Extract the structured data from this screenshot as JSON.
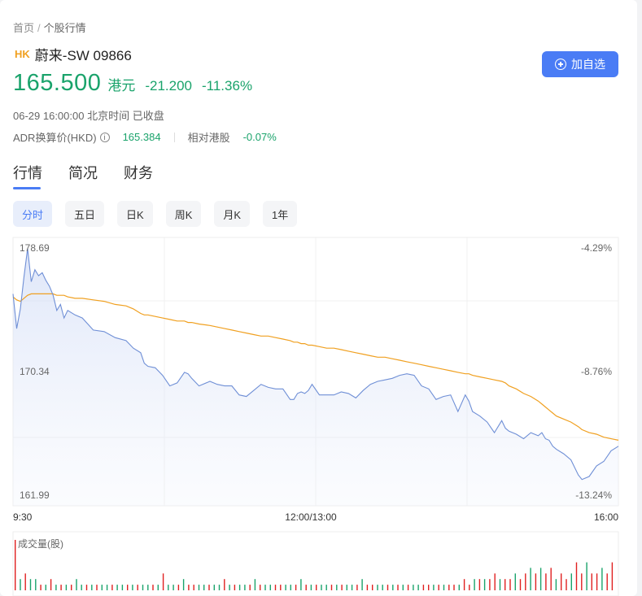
{
  "breadcrumb": {
    "home": "首页",
    "separator": "/",
    "current": "个股行情"
  },
  "stock": {
    "market": "HK",
    "name": "蔚来-SW 09866",
    "price": "165.500",
    "unit": "港元",
    "change": "-21.200",
    "change_pct": "-11.36%",
    "time_status": "06-29 16:00:00 北京时间 已收盘"
  },
  "adr": {
    "label": "ADR换算价(HKD)",
    "value": "165.384",
    "rel_label": "相对港股",
    "rel_value": "-0.07%"
  },
  "add_button": "加自选",
  "tabs": [
    "行情",
    "简况",
    "财务"
  ],
  "periods": [
    "分时",
    "五日",
    "日K",
    "周K",
    "月K",
    "1年"
  ],
  "volume_title": "成交量(股)",
  "colors": {
    "up": "#e02020",
    "down": "#1aa36b",
    "accent": "#4a7cf5",
    "price_line": "#6f8fd6",
    "avg_line": "#f0a020"
  },
  "chart_data": {
    "type": "line",
    "y_left_ticks": [
      "178.69",
      "170.34",
      "161.99"
    ],
    "y_right_ticks": [
      "-4.29%",
      "-8.76%",
      "-13.24%"
    ],
    "x_ticks": [
      "9:30",
      "12:00/13:00",
      "16:00"
    ],
    "ylim": [
      161.99,
      178.69
    ],
    "x": [
      0,
      2,
      4,
      6,
      8,
      10,
      12,
      14,
      16,
      18,
      20,
      22,
      24,
      26,
      28,
      30,
      34,
      38,
      44,
      50,
      56,
      62,
      66,
      70,
      72,
      74,
      78,
      82,
      86,
      90,
      94,
      96,
      98,
      102,
      108,
      112,
      116,
      120,
      124,
      128,
      132,
      136,
      140,
      144,
      148,
      152,
      154,
      156,
      158,
      160,
      162,
      164,
      168,
      172,
      176,
      180,
      184,
      188,
      192,
      196,
      200,
      204,
      208,
      212,
      216,
      220,
      224,
      228,
      232,
      236,
      240,
      244,
      248,
      250,
      252,
      256,
      260,
      264,
      268,
      270,
      272,
      276,
      280,
      284,
      288,
      290,
      292,
      294,
      296,
      298,
      302,
      306,
      310,
      312,
      316,
      320,
      324,
      328,
      332
    ],
    "price": [
      175.6,
      173.3,
      174.6,
      176.7,
      178.6,
      176.4,
      177.2,
      176.8,
      177.0,
      176.5,
      176.1,
      175.5,
      174.5,
      174.9,
      174.0,
      174.5,
      174.2,
      174.0,
      173.2,
      173.1,
      172.7,
      172.5,
      172.0,
      171.7,
      171.0,
      170.8,
      170.7,
      170.2,
      169.5,
      169.7,
      170.4,
      170.3,
      170.0,
      169.5,
      169.8,
      169.6,
      169.5,
      169.5,
      168.9,
      168.8,
      169.2,
      169.6,
      169.4,
      169.3,
      169.3,
      168.6,
      168.6,
      169.0,
      169.1,
      169.0,
      169.2,
      169.6,
      168.9,
      168.9,
      168.9,
      169.1,
      169.0,
      168.7,
      169.2,
      169.6,
      169.8,
      169.9,
      170.0,
      170.2,
      170.3,
      170.2,
      169.5,
      169.3,
      168.6,
      168.8,
      168.9,
      167.8,
      168.9,
      168.5,
      167.8,
      167.5,
      167.1,
      166.4,
      167.2,
      166.7,
      166.5,
      166.3,
      166.0,
      166.4,
      166.2,
      166.4,
      166.0,
      165.9,
      165.5,
      165.3,
      165.0,
      164.6,
      163.6,
      163.3,
      163.5,
      164.2,
      164.5,
      165.2,
      165.5
    ],
    "avg": [
      175.4,
      175.2,
      175.1,
      175.3,
      175.5,
      175.6,
      175.6,
      175.6,
      175.6,
      175.6,
      175.6,
      175.6,
      175.5,
      175.5,
      175.5,
      175.4,
      175.3,
      175.3,
      175.2,
      175.1,
      174.9,
      174.8,
      174.6,
      174.3,
      174.2,
      174.2,
      174.1,
      174.0,
      173.9,
      173.8,
      173.8,
      173.7,
      173.7,
      173.6,
      173.5,
      173.4,
      173.3,
      173.2,
      173.1,
      173.0,
      172.9,
      172.8,
      172.8,
      172.7,
      172.6,
      172.5,
      172.4,
      172.4,
      172.3,
      172.3,
      172.2,
      172.2,
      172.1,
      172.0,
      172.0,
      171.9,
      171.8,
      171.7,
      171.6,
      171.5,
      171.4,
      171.4,
      171.3,
      171.2,
      171.1,
      171.0,
      170.9,
      170.8,
      170.7,
      170.6,
      170.5,
      170.4,
      170.3,
      170.3,
      170.2,
      170.1,
      170.0,
      169.9,
      169.8,
      169.7,
      169.5,
      169.3,
      169.0,
      168.8,
      168.5,
      168.3,
      168.1,
      167.9,
      167.7,
      167.5,
      167.3,
      167.1,
      166.8,
      166.6,
      166.4,
      166.3,
      166.1,
      166.0,
      165.9
    ],
    "volume_series_name": "成交量(股)",
    "volume": [
      9,
      2,
      3,
      2,
      2,
      1,
      1,
      2,
      1,
      1,
      1,
      1,
      2,
      1,
      1,
      1,
      1,
      1,
      1,
      1,
      1,
      1,
      1,
      1,
      1,
      1,
      1,
      1,
      1,
      3,
      1,
      1,
      1,
      2,
      1,
      1,
      1,
      1,
      1,
      1,
      1,
      2,
      1,
      1,
      1,
      1,
      1,
      2,
      1,
      1,
      1,
      1,
      1,
      1,
      1,
      1,
      2,
      1,
      1,
      1,
      1,
      1,
      1,
      1,
      1,
      1,
      1,
      1,
      2,
      1,
      1,
      1,
      1,
      1,
      1,
      1,
      1,
      1,
      1,
      1,
      1,
      1,
      1,
      1,
      1,
      1,
      1,
      1,
      2,
      1,
      2,
      2,
      2,
      2,
      3,
      2,
      2,
      2,
      3,
      2,
      3,
      4,
      3,
      4,
      3,
      4,
      2,
      3,
      2,
      3,
      5,
      3,
      5,
      3,
      3,
      4,
      3,
      5
    ],
    "volume_up": [
      1,
      0,
      1,
      0,
      0,
      1,
      0,
      1,
      0,
      1,
      0,
      1,
      0,
      0,
      1,
      0,
      1,
      0,
      0,
      1,
      0,
      0,
      1,
      0,
      1,
      0,
      0,
      1,
      0,
      1,
      0,
      0,
      1,
      0,
      1,
      1,
      0,
      0,
      1,
      0,
      0,
      1,
      0,
      1,
      0,
      0,
      1,
      0,
      1,
      0,
      0,
      1,
      1,
      0,
      0,
      1,
      0,
      1,
      0,
      1,
      0,
      0,
      1,
      0,
      1,
      0,
      0,
      1,
      0,
      1,
      1,
      0,
      0,
      1,
      0,
      1,
      0,
      1,
      0,
      0,
      1,
      1,
      0,
      1,
      0,
      1,
      1,
      0,
      1,
      1,
      0,
      1,
      0,
      1,
      1,
      0,
      1,
      1,
      0,
      1,
      1,
      0,
      1,
      0,
      1,
      1,
      0,
      1,
      1,
      0,
      1,
      1,
      0,
      1,
      1,
      0,
      1,
      1
    ]
  }
}
